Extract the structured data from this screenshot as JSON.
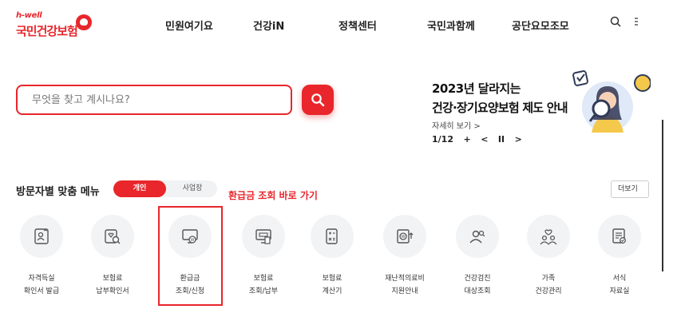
{
  "header": {
    "logo_sub": "h-well",
    "logo_main": "국민건강보험",
    "nav": [
      "민원여기요",
      "건강iN",
      "정책센터",
      "국민과함께",
      "공단요모조모"
    ],
    "icons": [
      "search-icon",
      "menu-icon"
    ]
  },
  "search": {
    "placeholder": "무엇을 찾고 계시나요?"
  },
  "banner": {
    "title_line1": "2023년 달라지는",
    "title_line2": "건강·장기요양보험 제도 안내",
    "more": "자세히 보기 >",
    "pager": "1/12",
    "controls": [
      "+",
      "<",
      "II",
      ">"
    ]
  },
  "audience": {
    "label": "방문자별 맞춤 메뉴",
    "options": [
      "개인",
      "사업장"
    ],
    "selected": "개인",
    "more_label": "더보기"
  },
  "annotation": "환급금 조회 바로 가기",
  "quick_menu": [
    {
      "line1": "자격득실",
      "line2": "확인서 발급",
      "icon": "id-card-icon"
    },
    {
      "line1": "보험료",
      "line2": "납부확인서",
      "icon": "document-search-icon"
    },
    {
      "line1": "환급금",
      "line2": "조회/신청",
      "icon": "refund-monitor-icon"
    },
    {
      "line1": "보험료",
      "line2": "조회/납부",
      "icon": "bill-payment-icon"
    },
    {
      "line1": "보험료",
      "line2": "계산기",
      "icon": "calculator-icon"
    },
    {
      "line1": "재난적의료비",
      "line2": "지원안내",
      "icon": "medical-support-icon"
    },
    {
      "line1": "건강검진",
      "line2": "대상조회",
      "icon": "health-checkup-icon"
    },
    {
      "line1": "가족",
      "line2": "건강관리",
      "icon": "family-care-icon"
    },
    {
      "line1": "서식",
      "line2": "자료실",
      "icon": "forms-library-icon"
    }
  ],
  "colors": {
    "brand_red": "#e8262b",
    "icon_bg": "#f2f3f5",
    "text_dark": "#222222"
  }
}
